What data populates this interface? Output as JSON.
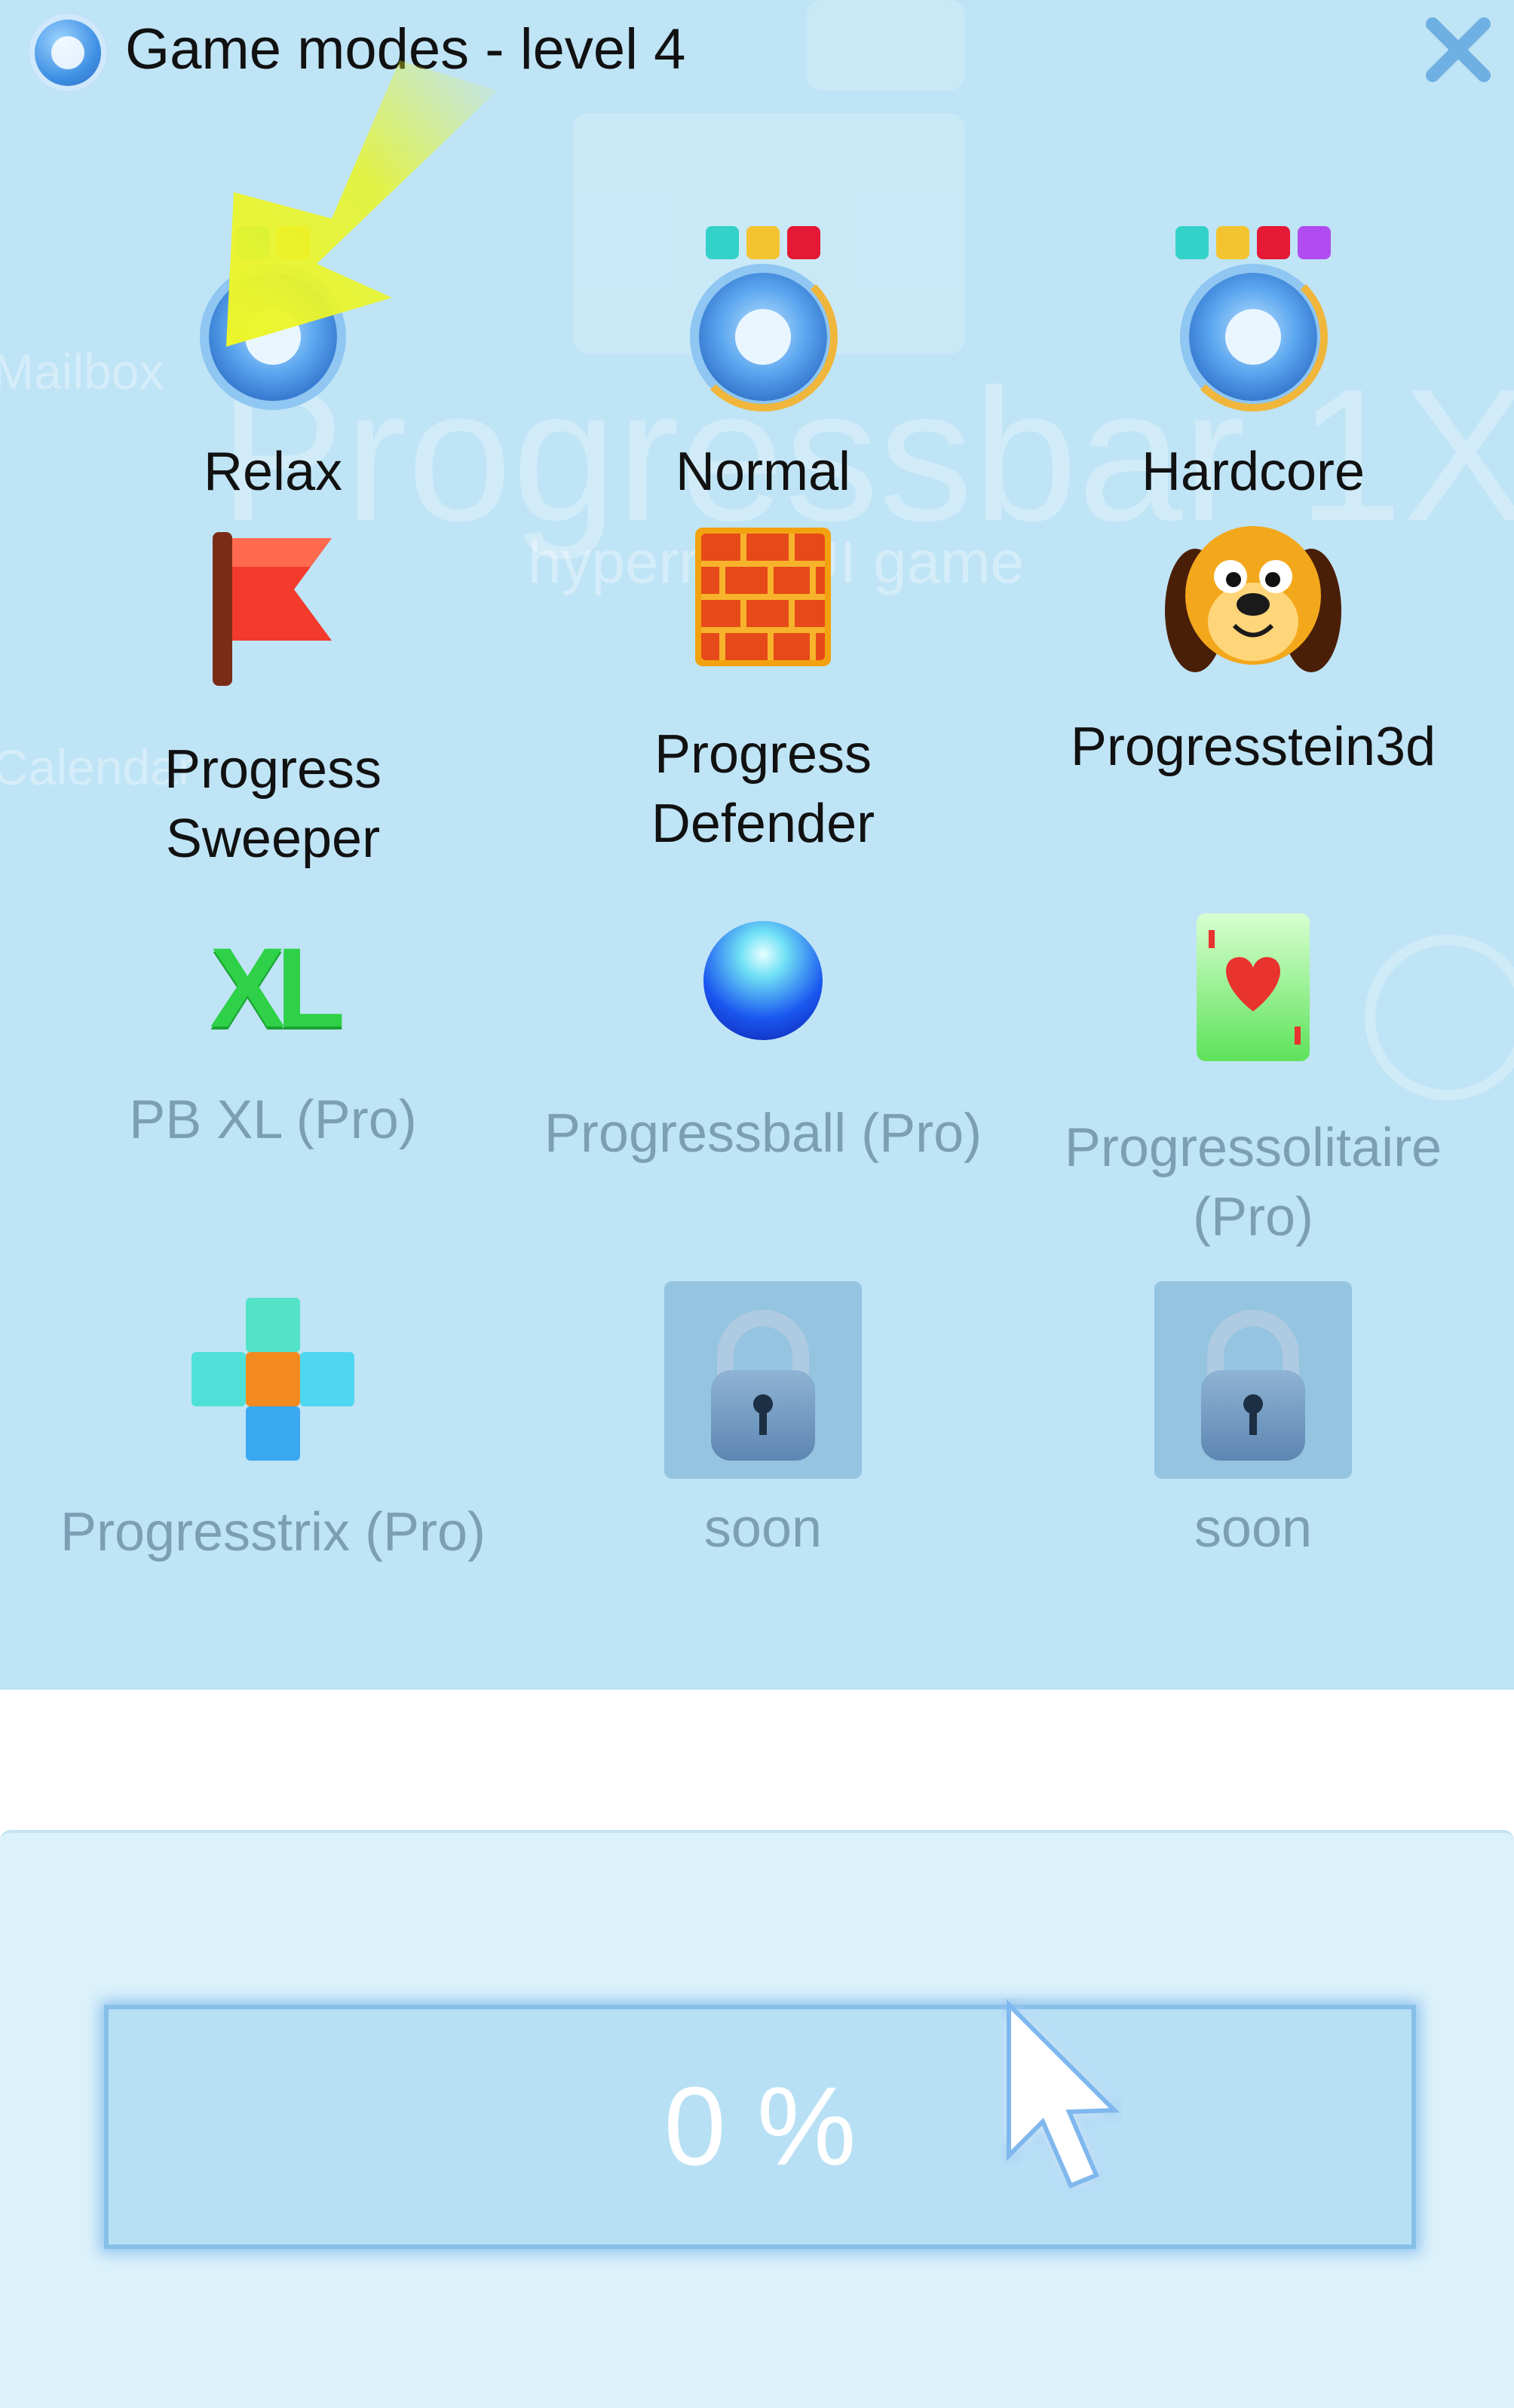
{
  "dialog": {
    "title": "Game modes - level 4",
    "close_icon": "close-x-icon"
  },
  "background": {
    "app_title": "Progressbar 1X",
    "app_subtitle": "hyperreal UI game",
    "mailbox": "Mailbox",
    "calendar": "Calendar"
  },
  "modes": [
    {
      "label": "Relax",
      "icon": "progressbar-icon",
      "pro": false,
      "dot_colors": [
        "#34d1c9",
        "#f4c430"
      ]
    },
    {
      "label": "Normal",
      "icon": "progressbar-icon",
      "pro": false,
      "dot_colors": [
        "#34d1c9",
        "#f4c430",
        "#e51935"
      ]
    },
    {
      "label": "Hardcore",
      "icon": "progressbar-icon",
      "pro": false,
      "dot_colors": [
        "#34d1c9",
        "#f4c430",
        "#e51935",
        "#b04cf0"
      ]
    },
    {
      "label": "Progress\nSweeper",
      "icon": "flag-icon",
      "pro": false
    },
    {
      "label": "Progress\nDefender",
      "icon": "brick-wall-icon",
      "pro": false
    },
    {
      "label": "Progresstein3d",
      "icon": "dog-face-icon",
      "pro": false
    },
    {
      "label": "PB XL (Pro)",
      "icon": "xl-icon",
      "pro": true,
      "icon_text": "XL"
    },
    {
      "label": "Progressball (Pro)",
      "icon": "ball-icon",
      "pro": true
    },
    {
      "label": "Progressolitaire\n(Pro)",
      "icon": "playing-card-icon",
      "pro": true
    },
    {
      "label": "Progresstrix (Pro)",
      "icon": "tetris-plus-icon",
      "pro": true
    },
    {
      "label": "soon",
      "icon": "lock-icon",
      "pro": true
    },
    {
      "label": "soon",
      "icon": "lock-icon",
      "pro": true
    }
  ],
  "progress": {
    "value": 0,
    "text": "0 %"
  },
  "pointer": {
    "icon": "arrow-cursor-icon"
  },
  "colors": {
    "dialog_bg": "#bfe4f6",
    "pro_text": "#7d9fb4",
    "highlight_arrow": "#e8f526"
  }
}
